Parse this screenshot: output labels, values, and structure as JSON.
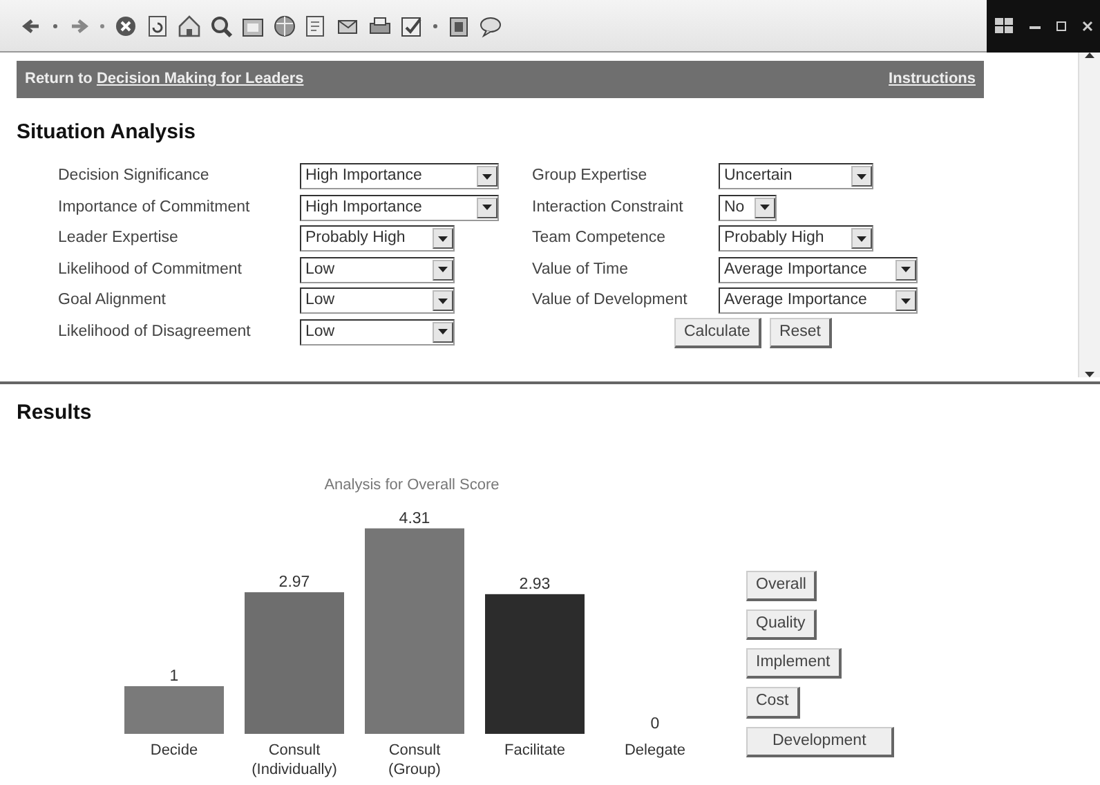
{
  "link_bar": {
    "prefix": "Return to ",
    "link": "Decision Making for Leaders",
    "instructions": "Instructions"
  },
  "situation": {
    "title": "Situation Analysis",
    "left": [
      {
        "label": "Decision Significance",
        "value": "High Importance"
      },
      {
        "label": "Importance of Commitment",
        "value": "High Importance"
      },
      {
        "label": "Leader Expertise",
        "value": "Probably High"
      },
      {
        "label": "Likelihood of Commitment",
        "value": "Low"
      },
      {
        "label": "Goal Alignment",
        "value": "Low"
      },
      {
        "label": "Likelihood of Disagreement",
        "value": "Low"
      }
    ],
    "right": [
      {
        "label": "Group Expertise",
        "value": "Uncertain"
      },
      {
        "label": "Interaction Constraint",
        "value": "No"
      },
      {
        "label": "Team Competence",
        "value": "Probably High"
      },
      {
        "label": "Value of Time",
        "value": "Average Importance"
      },
      {
        "label": "Value of Development",
        "value": "Average Importance"
      }
    ],
    "buttons": [
      "Calculate",
      "Reset"
    ]
  },
  "results": {
    "title": "Results",
    "chart_data": {
      "type": "bar",
      "title": "Analysis for Overall Score",
      "categories": [
        "Decide",
        "Consult\n(Individually)",
        "Consult\n(Group)",
        "Facilitate",
        "Delegate"
      ],
      "series": [
        {
          "colors": [
            "#7a7a7a",
            "#6e6e6e",
            "#767676",
            "#2c2c2c",
            null
          ],
          "values": [
            1,
            2.97,
            4.31,
            2.93,
            0
          ]
        }
      ],
      "data_labels": true,
      "value_labels": [
        "1",
        "2.97",
        "4.31",
        "2.93",
        "0"
      ]
    },
    "buttons": [
      "Overall",
      "Quality",
      "Implement",
      "Cost",
      "Development"
    ]
  }
}
